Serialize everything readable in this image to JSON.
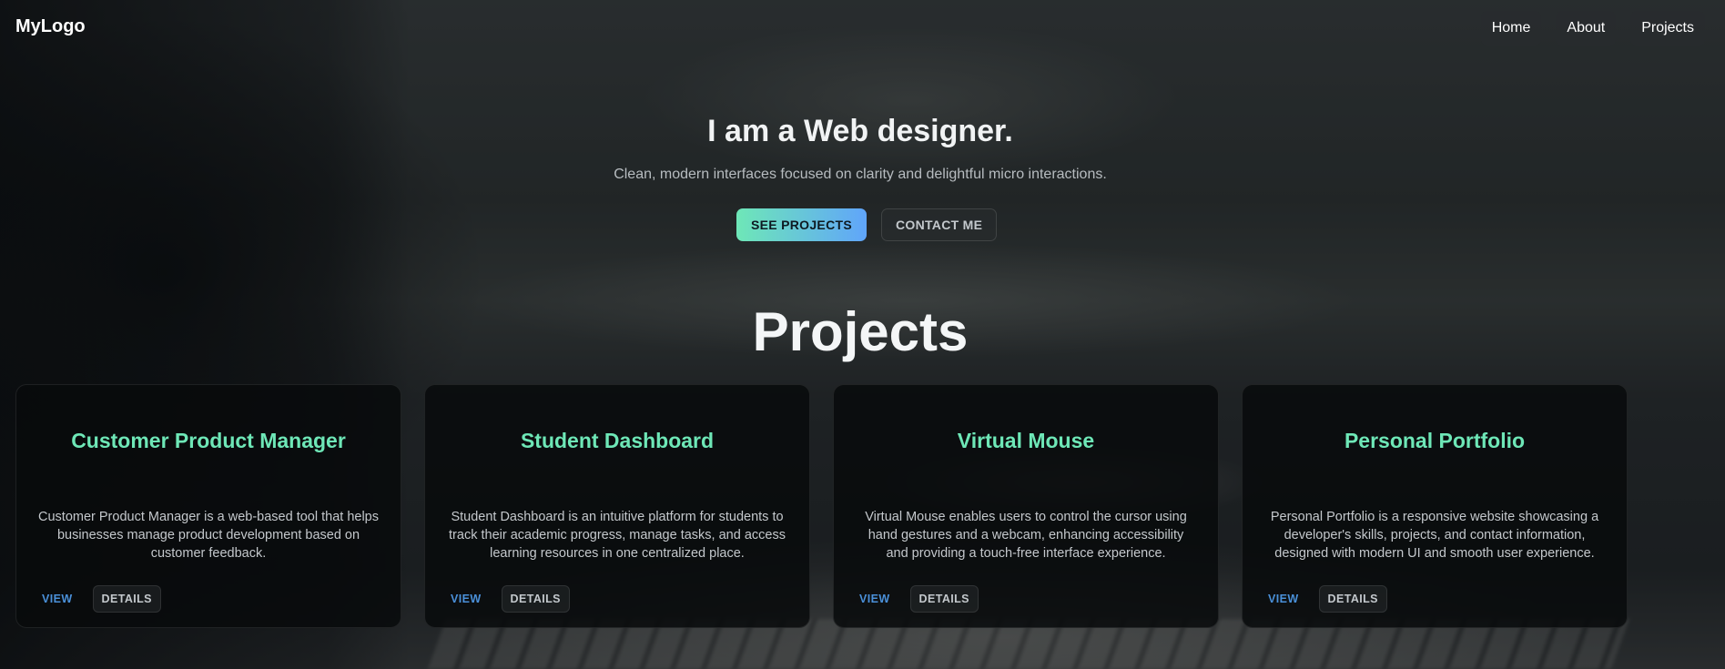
{
  "navbar": {
    "logo": "MyLogo",
    "links": [
      "Home",
      "About",
      "Projects"
    ]
  },
  "hero": {
    "title": "I am a Web designer.",
    "subtitle": "Clean, modern interfaces focused on clarity and delightful micro interactions.",
    "primary_button": "SEE PROJECTS",
    "secondary_button": "CONTACT ME"
  },
  "projects": {
    "title": "Projects",
    "cards": [
      {
        "title": "Customer Product Manager",
        "description": "Customer Product Manager is a web-based tool that helps businesses manage product development based on customer feedback.",
        "view_label": "VIEW",
        "details_label": "DETAILS"
      },
      {
        "title": "Student Dashboard",
        "description": "Student Dashboard is an intuitive platform for students to track their academic progress, manage tasks, and access learning resources in one centralized place.",
        "view_label": "VIEW",
        "details_label": "DETAILS"
      },
      {
        "title": "Virtual Mouse",
        "description": "Virtual Mouse enables users to control the cursor using hand gestures and a webcam, enhancing accessibility and providing a touch-free interface experience.",
        "view_label": "VIEW",
        "details_label": "DETAILS"
      },
      {
        "title": "Personal Portfolio",
        "description": "Personal Portfolio is a responsive website showcasing a developer's skills, projects, and contact information, designed with modern UI and smooth user experience.",
        "view_label": "VIEW",
        "details_label": "DETAILS"
      }
    ]
  },
  "colors": {
    "accent_green": "#6ee7b7",
    "accent_blue": "#60a5fa",
    "link_blue": "#4a90d9"
  }
}
